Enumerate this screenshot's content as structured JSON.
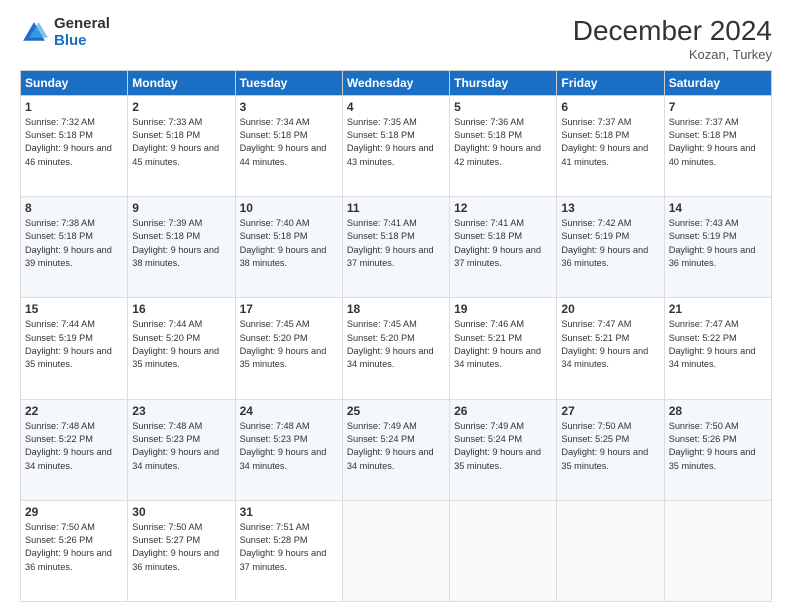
{
  "header": {
    "logo_general": "General",
    "logo_blue": "Blue",
    "title": "December 2024",
    "subtitle": "Kozan, Turkey"
  },
  "days_of_week": [
    "Sunday",
    "Monday",
    "Tuesday",
    "Wednesday",
    "Thursday",
    "Friday",
    "Saturday"
  ],
  "weeks": [
    [
      {
        "day": "1",
        "text": "Sunrise: 7:32 AM\nSunset: 5:18 PM\nDaylight: 9 hours and 46 minutes."
      },
      {
        "day": "2",
        "text": "Sunrise: 7:33 AM\nSunset: 5:18 PM\nDaylight: 9 hours and 45 minutes."
      },
      {
        "day": "3",
        "text": "Sunrise: 7:34 AM\nSunset: 5:18 PM\nDaylight: 9 hours and 44 minutes."
      },
      {
        "day": "4",
        "text": "Sunrise: 7:35 AM\nSunset: 5:18 PM\nDaylight: 9 hours and 43 minutes."
      },
      {
        "day": "5",
        "text": "Sunrise: 7:36 AM\nSunset: 5:18 PM\nDaylight: 9 hours and 42 minutes."
      },
      {
        "day": "6",
        "text": "Sunrise: 7:37 AM\nSunset: 5:18 PM\nDaylight: 9 hours and 41 minutes."
      },
      {
        "day": "7",
        "text": "Sunrise: 7:37 AM\nSunset: 5:18 PM\nDaylight: 9 hours and 40 minutes."
      }
    ],
    [
      {
        "day": "8",
        "text": "Sunrise: 7:38 AM\nSunset: 5:18 PM\nDaylight: 9 hours and 39 minutes."
      },
      {
        "day": "9",
        "text": "Sunrise: 7:39 AM\nSunset: 5:18 PM\nDaylight: 9 hours and 38 minutes."
      },
      {
        "day": "10",
        "text": "Sunrise: 7:40 AM\nSunset: 5:18 PM\nDaylight: 9 hours and 38 minutes."
      },
      {
        "day": "11",
        "text": "Sunrise: 7:41 AM\nSunset: 5:18 PM\nDaylight: 9 hours and 37 minutes."
      },
      {
        "day": "12",
        "text": "Sunrise: 7:41 AM\nSunset: 5:18 PM\nDaylight: 9 hours and 37 minutes."
      },
      {
        "day": "13",
        "text": "Sunrise: 7:42 AM\nSunset: 5:19 PM\nDaylight: 9 hours and 36 minutes."
      },
      {
        "day": "14",
        "text": "Sunrise: 7:43 AM\nSunset: 5:19 PM\nDaylight: 9 hours and 36 minutes."
      }
    ],
    [
      {
        "day": "15",
        "text": "Sunrise: 7:44 AM\nSunset: 5:19 PM\nDaylight: 9 hours and 35 minutes."
      },
      {
        "day": "16",
        "text": "Sunrise: 7:44 AM\nSunset: 5:20 PM\nDaylight: 9 hours and 35 minutes."
      },
      {
        "day": "17",
        "text": "Sunrise: 7:45 AM\nSunset: 5:20 PM\nDaylight: 9 hours and 35 minutes."
      },
      {
        "day": "18",
        "text": "Sunrise: 7:45 AM\nSunset: 5:20 PM\nDaylight: 9 hours and 34 minutes."
      },
      {
        "day": "19",
        "text": "Sunrise: 7:46 AM\nSunset: 5:21 PM\nDaylight: 9 hours and 34 minutes."
      },
      {
        "day": "20",
        "text": "Sunrise: 7:47 AM\nSunset: 5:21 PM\nDaylight: 9 hours and 34 minutes."
      },
      {
        "day": "21",
        "text": "Sunrise: 7:47 AM\nSunset: 5:22 PM\nDaylight: 9 hours and 34 minutes."
      }
    ],
    [
      {
        "day": "22",
        "text": "Sunrise: 7:48 AM\nSunset: 5:22 PM\nDaylight: 9 hours and 34 minutes."
      },
      {
        "day": "23",
        "text": "Sunrise: 7:48 AM\nSunset: 5:23 PM\nDaylight: 9 hours and 34 minutes."
      },
      {
        "day": "24",
        "text": "Sunrise: 7:48 AM\nSunset: 5:23 PM\nDaylight: 9 hours and 34 minutes."
      },
      {
        "day": "25",
        "text": "Sunrise: 7:49 AM\nSunset: 5:24 PM\nDaylight: 9 hours and 34 minutes."
      },
      {
        "day": "26",
        "text": "Sunrise: 7:49 AM\nSunset: 5:24 PM\nDaylight: 9 hours and 35 minutes."
      },
      {
        "day": "27",
        "text": "Sunrise: 7:50 AM\nSunset: 5:25 PM\nDaylight: 9 hours and 35 minutes."
      },
      {
        "day": "28",
        "text": "Sunrise: 7:50 AM\nSunset: 5:26 PM\nDaylight: 9 hours and 35 minutes."
      }
    ],
    [
      {
        "day": "29",
        "text": "Sunrise: 7:50 AM\nSunset: 5:26 PM\nDaylight: 9 hours and 36 minutes."
      },
      {
        "day": "30",
        "text": "Sunrise: 7:50 AM\nSunset: 5:27 PM\nDaylight: 9 hours and 36 minutes."
      },
      {
        "day": "31",
        "text": "Sunrise: 7:51 AM\nSunset: 5:28 PM\nDaylight: 9 hours and 37 minutes."
      },
      {
        "day": "",
        "text": ""
      },
      {
        "day": "",
        "text": ""
      },
      {
        "day": "",
        "text": ""
      },
      {
        "day": "",
        "text": ""
      }
    ]
  ]
}
